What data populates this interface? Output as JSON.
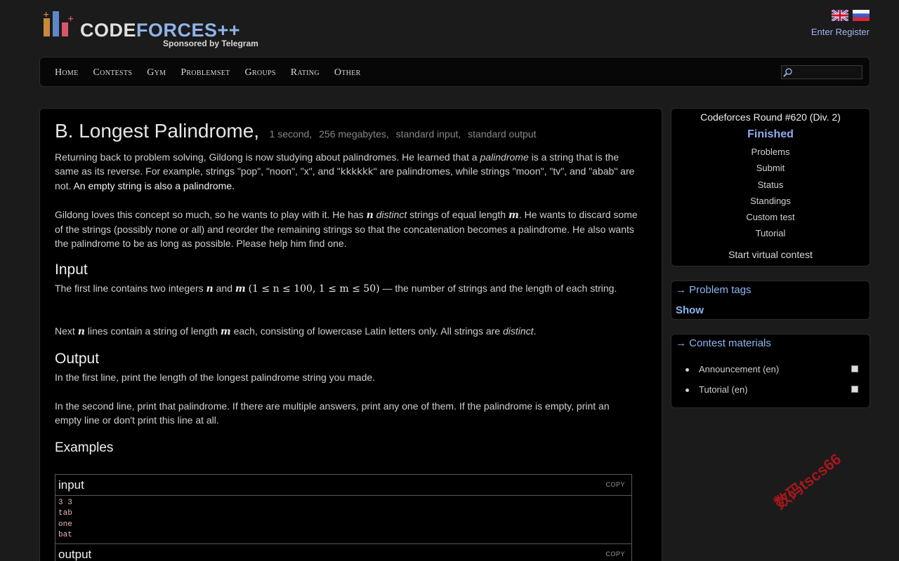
{
  "header": {
    "logo_word_code": "CODE",
    "logo_word_forces": "FORCES++",
    "logo_sub": "Sponsored by Telegram",
    "auth_enter": "Enter",
    "auth_register": "Register"
  },
  "nav": {
    "items": [
      "Home",
      "Contests",
      "Gym",
      "Problemset",
      "Groups",
      "Rating",
      "Other"
    ]
  },
  "problem": {
    "title": "B. Longest Palindrome,",
    "time_limit": "1 second,",
    "memory_limit": "256 megabytes,",
    "input_file": "standard input,",
    "output_file": "standard output",
    "p1_a": "Returning back to problem solving, Gildong is now studying about palindromes. He learned that a ",
    "p1_em": "palindrome",
    "p1_b": " is a string that is the same as its reverse. For example, strings \"pop\", \"noon\", \"x\", and \"",
    "p1_k": "kkkkkk",
    "p1_c": "\" are palindromes, while strings \"moon\", \"tv\", and \"abab\" are not. ",
    "p1_bright": "An empty string is also a palindrome.",
    "p2_a": "Gildong loves this concept so much, so he wants to play with it. He has ",
    "p2_n": "n",
    "p2_em": "distinct",
    "p2_b": " strings of equal length ",
    "p2_m": "m",
    "p2_c": ". He wants to discard some of the strings (possibly none or all) and reorder the remaining strings so that the concatenation becomes a palindrome. He also wants the palindrome to be as long as possible. Please help him find one.",
    "input_title": "Input",
    "in1_a": "The first line contains two integers ",
    "in1_n": "n",
    "in1_and": " and ",
    "in1_m": "m",
    "in1_cons": "(1 ≤ n ≤ 100, 1 ≤ m ≤ 50)",
    "in1_b": " — the number of strings and the length of each string.",
    "in2_a": "Next ",
    "in2_n": "n",
    "in2_b": " lines contain a string of length ",
    "in2_m": "m",
    "in2_c": " each, consisting of lowercase Latin letters only. All strings are ",
    "in2_em": "distinct",
    "in2_d": ".",
    "output_title": "Output",
    "out1": "In the first line, print the length of the longest palindrome string you made.",
    "out2": "In the second line, print that palindrome. If there are multiple answers, print any one of them. If the palindrome is empty, print an empty line or don't print this line at all.",
    "examples_title": "Examples",
    "example_input_label": "input",
    "example_output_label": "output",
    "copy_label": "COPY",
    "example_input_lines": [
      "3 3",
      "tab",
      "one",
      "bat"
    ]
  },
  "sidebar": {
    "contest_name": "Codeforces Round #620 (Div. 2)",
    "contest_status": "Finished",
    "links": [
      "Problems",
      "Submit",
      "Status",
      "Standings",
      "Custom test",
      "Tutorial"
    ],
    "virtual": "Start virtual contest",
    "tags_title": "→ Problem tags",
    "tags_show": "Show",
    "materials_title": "→ Contest materials",
    "materials": [
      "Announcement (en)",
      "Tutorial (en)"
    ]
  },
  "watermark": "数码tscs66",
  "colors": {
    "accent_link": "#8fb4f0",
    "sample_text": "#f4b8b8",
    "background": "#000000"
  }
}
